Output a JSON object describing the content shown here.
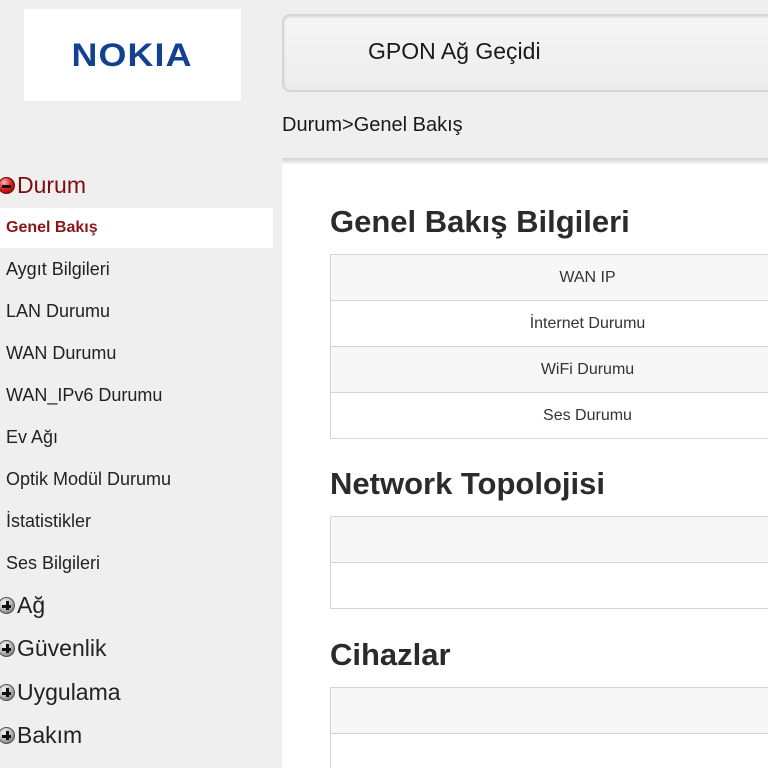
{
  "logo": {
    "text": "NOKIA",
    "color": "#124191"
  },
  "header": {
    "title": "GPON Ağ Geçidi"
  },
  "breadcrumb": "Durum>Genel Bakış",
  "sidebar": {
    "groups": [
      {
        "label": "Durum",
        "expanded": true,
        "icon": "minus-circle-icon"
      },
      {
        "label": "Ağ",
        "expanded": false,
        "icon": "plus-circle-icon"
      },
      {
        "label": "Güvenlik",
        "expanded": false,
        "icon": "plus-circle-icon"
      },
      {
        "label": "Uygulama",
        "expanded": false,
        "icon": "plus-circle-icon"
      },
      {
        "label": "Bakım",
        "expanded": false,
        "icon": "plus-circle-icon"
      }
    ],
    "items": [
      {
        "label": "Genel Bakış",
        "selected": true
      },
      {
        "label": "Aygıt Bilgileri"
      },
      {
        "label": "LAN Durumu"
      },
      {
        "label": "WAN Durumu"
      },
      {
        "label": "WAN_IPv6 Durumu"
      },
      {
        "label": "Ev Ağı"
      },
      {
        "label": "Optik Modül Durumu"
      },
      {
        "label": "İstatistikler"
      },
      {
        "label": "Ses Bilgileri"
      }
    ]
  },
  "sections": {
    "overview": {
      "title": "Genel Bakış Bilgileri",
      "rows": [
        "WAN IP",
        "İnternet Durumu",
        "WiFi Durumu",
        "Ses Durumu"
      ]
    },
    "topology": {
      "title": "Network Topolojisi",
      "rows": [
        "",
        ""
      ]
    },
    "devices": {
      "title": "Cihazlar",
      "rows": [
        "",
        ""
      ]
    }
  },
  "colors": {
    "accent": "#8a1717",
    "brand": "#124191"
  }
}
